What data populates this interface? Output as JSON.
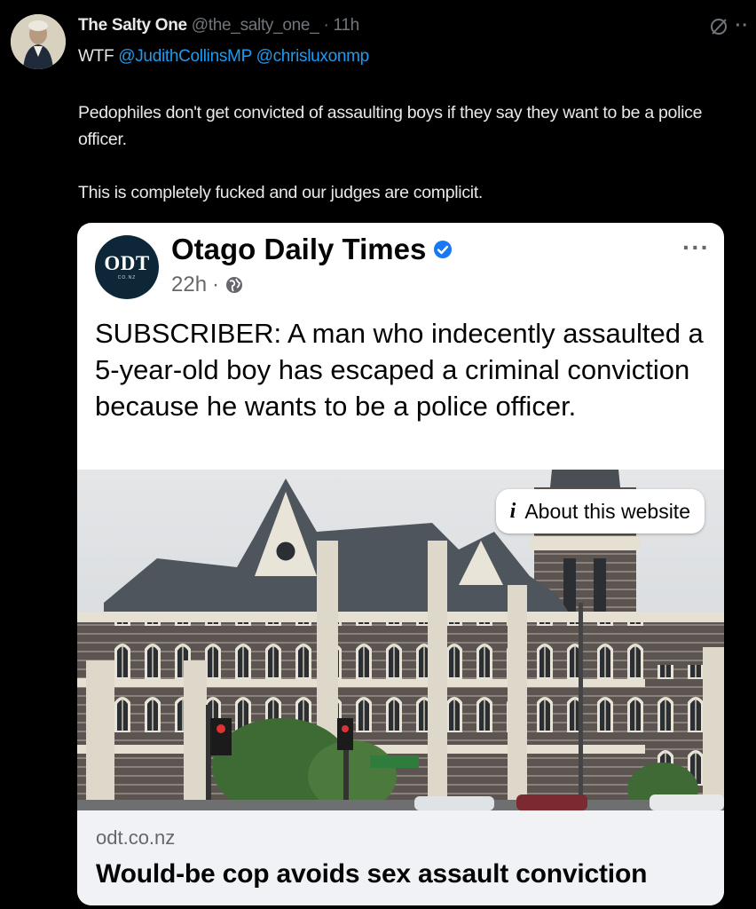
{
  "tweet": {
    "author_name": "The Salty One",
    "author_handle": "@the_salty_one_",
    "separator": "·",
    "time": "11h",
    "reply_prefix": "WTF",
    "mention_1": "@JudithCollinsMP",
    "mention_2": "@chrisluxonmp",
    "text_p1": "Pedophiles don't get convicted of assaulting boys if they say they want to be a police officer.",
    "text_p2": "This is completely fucked and our judges are complicit.",
    "more_label": "··"
  },
  "embed": {
    "page_name": "Otago Daily Times",
    "logo_text": "ODT",
    "logo_subtext": "CO.NZ",
    "time": "22h",
    "separator": "·",
    "more_label": "···",
    "post_text": "SUBSCRIBER: A man who indecently assaulted a 5-year-old boy has escaped a criminal conviction because he wants to be a police officer.",
    "about_icon": "i",
    "about_label": "About this website",
    "link_domain": "odt.co.nz",
    "link_headline": "Would-be cop avoids sex assault conviction"
  },
  "icons": {
    "grok": "slashed-circle-icon",
    "verified": "verified-badge-icon",
    "globe": "globe-icon"
  },
  "colors": {
    "background": "#000000",
    "mention": "#1d9bf0",
    "verified": "#1877f2",
    "card": "#ffffff"
  }
}
